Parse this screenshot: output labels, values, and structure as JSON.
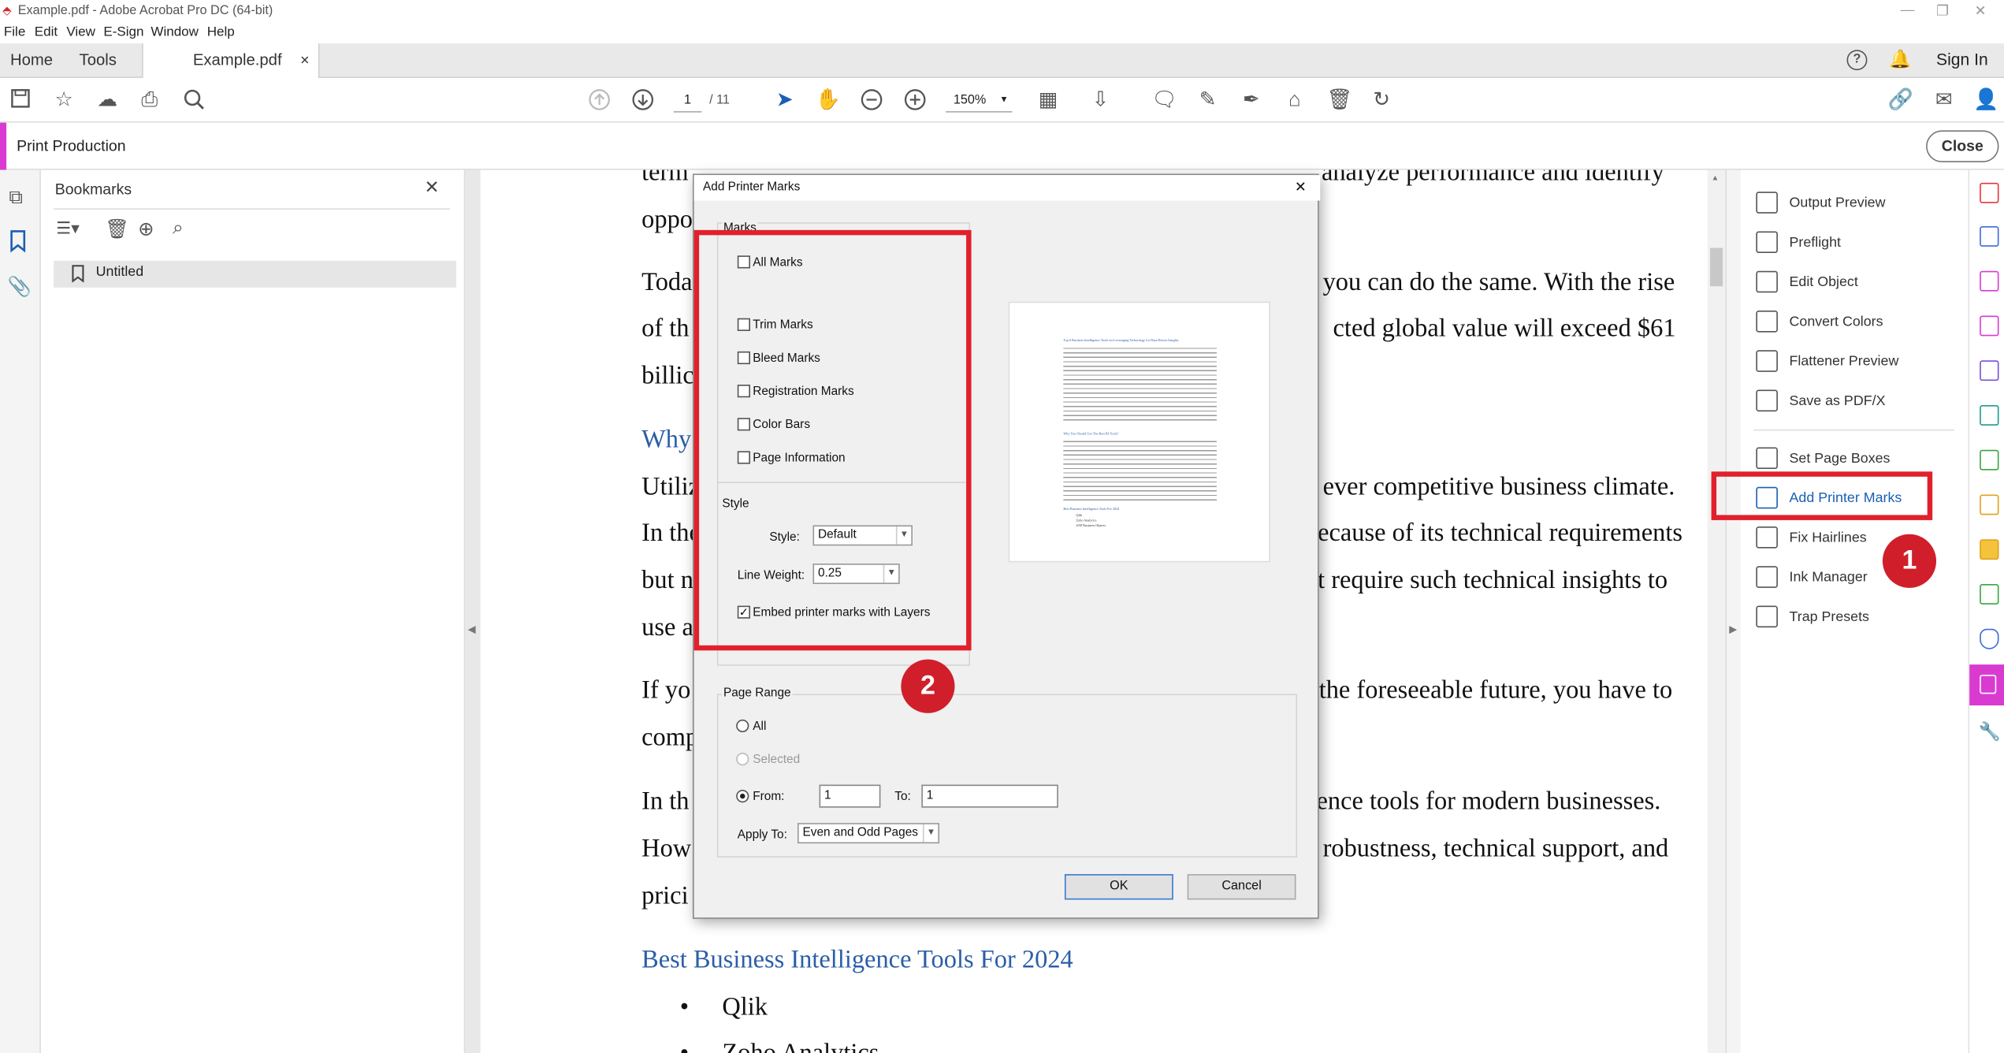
{
  "window": {
    "title": "Example.pdf - Adobe Acrobat Pro DC (64-bit)"
  },
  "menu": [
    "File",
    "Edit",
    "View",
    "E-Sign",
    "Window",
    "Help"
  ],
  "tabs": {
    "home": "Home",
    "tools": "Tools",
    "document": "Example.pdf",
    "close": "×"
  },
  "account": {
    "sign_in": "Sign In"
  },
  "toolbar": {
    "page_current": "1",
    "page_total": "/ 11",
    "zoom": "150%"
  },
  "panel_header": {
    "title": "Print Production",
    "close": "Close"
  },
  "bookmarks": {
    "title": "Bookmarks",
    "close": "✕",
    "items": [
      "Untitled"
    ]
  },
  "document": {
    "lines": [
      {
        "text": "term",
        "text2": "analyze performance and identify"
      },
      {
        "text": "oppo"
      },
      {
        "text": "Toda",
        "text2": "you can do the same. With the rise"
      },
      {
        "text": "of th",
        "text2": "cted global value will exceed $61"
      },
      {
        "text": "billic"
      },
      {
        "text": "Why"
      },
      {
        "text": "Utiliz",
        "text2": "ever competitive business climate."
      },
      {
        "text": "In the",
        "text2": "ecause of its technical requirements"
      },
      {
        "text": "but n",
        "text2": "t require such technical insights to"
      },
      {
        "text": "use a"
      },
      {
        "text": "If yo",
        "text2": "the foreseeable future, you have to"
      },
      {
        "text": "comp"
      },
      {
        "text": "In th",
        "text2": "ence tools for modern businesses."
      },
      {
        "text": "How",
        "text2": "robustness, technical support, and"
      },
      {
        "text": "prici"
      }
    ],
    "heading": "Best Business Intelligence Tools For 2024",
    "bullets": [
      "Qlik",
      "Zoho Analytics"
    ]
  },
  "tools_panel": {
    "items": [
      "Output Preview",
      "Preflight",
      "Edit Object",
      "Convert Colors",
      "Flattener Preview",
      "Save as PDF/X",
      "Set Page Boxes",
      "Add Printer Marks",
      "Fix Hairlines",
      "Ink Manager",
      "Trap Presets"
    ]
  },
  "dialog": {
    "title": "Add Printer Marks",
    "close": "✕",
    "marks_label": "Marks",
    "marks": [
      {
        "label": "All Marks",
        "checked": false
      },
      {
        "label": "Trim Marks",
        "checked": false
      },
      {
        "label": "Bleed Marks",
        "checked": false
      },
      {
        "label": "Registration Marks",
        "checked": false
      },
      {
        "label": "Color Bars",
        "checked": false
      },
      {
        "label": "Page Information",
        "checked": false
      }
    ],
    "style_label": "Style",
    "style_field_label": "Style:",
    "style_value": "Default",
    "line_weight_label": "Line Weight:",
    "line_weight_value": "0.25",
    "embed_label": "Embed printer marks with Layers",
    "embed_checked": true,
    "page_range_label": "Page Range",
    "range_all": "All",
    "range_selected": "Selected",
    "range_from": "From:",
    "from_value": "1",
    "to_label": "To:",
    "to_value": "1",
    "apply_to_label": "Apply To:",
    "apply_to_value": "Even and Odd Pages",
    "ok": "OK",
    "cancel": "Cancel",
    "preview_title": "Top 6 Business Intelligence Tools for Leveraging Technology for Data-Driven Insights",
    "preview_subheading": "Why You Should Use The Best BI Tools?",
    "preview_heading2": "Best Business Intelligence Tools For 2024",
    "preview_bullets": [
      "Qlik",
      "Zoho Analytics",
      "SAP Business Objects"
    ]
  },
  "annotations": {
    "badge1": "1",
    "badge2": "2"
  },
  "colors": {
    "accent": "#d93bd1",
    "callout": "#e1202b",
    "link": "#2b5ea8"
  }
}
